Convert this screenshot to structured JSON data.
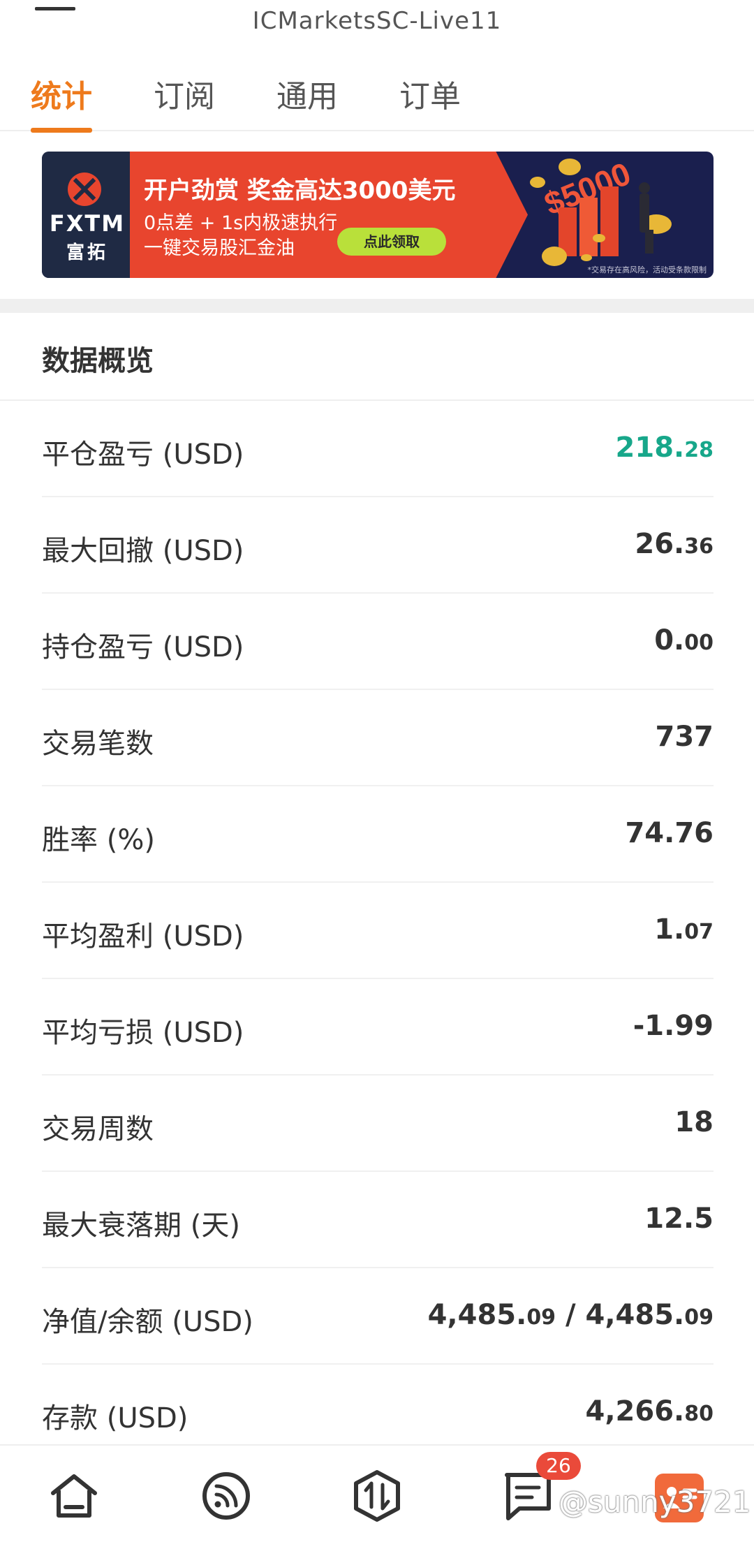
{
  "header": {
    "title": "ICMarketsSC-Live11"
  },
  "tabs": [
    {
      "label": "统计",
      "active": true
    },
    {
      "label": "订阅",
      "active": false
    },
    {
      "label": "通用",
      "active": false
    },
    {
      "label": "订单",
      "active": false
    }
  ],
  "banner": {
    "logo_text": "FXTM",
    "logo_sub": "富拓",
    "headline": "开户劲赏 奖金高达3000美元",
    "line1": "0点差 + 1s内极速执行",
    "line2": "一键交易股汇金油",
    "cta": "点此领取",
    "art_text": "$5000",
    "disclaimer": "*交易存在高风险，活动受条款限制"
  },
  "overview": {
    "title": "数据概览",
    "rows": [
      {
        "label": "平仓盈亏 (USD)",
        "main": "218.",
        "decimal": "28",
        "color": "#17a78a"
      },
      {
        "label": "最大回撤 (USD)",
        "main": "26.",
        "decimal": "36"
      },
      {
        "label": "持仓盈亏 (USD)",
        "main": "0.",
        "decimal": "00"
      },
      {
        "label": "交易笔数",
        "main": "737",
        "decimal": ""
      },
      {
        "label": "胜率 (%)",
        "main": "74.76",
        "decimal": ""
      },
      {
        "label": "平均盈利 (USD)",
        "main": "1.",
        "decimal": "07"
      },
      {
        "label": "平均亏损 (USD)",
        "main": "-1.99",
        "decimal": ""
      },
      {
        "label": "交易周数",
        "main": "18",
        "decimal": ""
      },
      {
        "label": "最大衰落期 (天)",
        "main": "12.5",
        "decimal": ""
      },
      {
        "label": "净值/余额 (USD)",
        "main": "4,485.",
        "decimal": "09",
        "main2": " / 4,485.",
        "decimal2": "09"
      },
      {
        "label": "存款 (USD)",
        "main": "4,266.",
        "decimal": "80"
      }
    ]
  },
  "bottom_nav": {
    "items": [
      {
        "icon": "home-icon"
      },
      {
        "icon": "signal-feed-icon"
      },
      {
        "icon": "trade-arrows-icon"
      },
      {
        "icon": "messages-icon",
        "badge": "26"
      },
      {
        "icon": "profile-icon"
      }
    ],
    "watermark": "@sunny3721"
  },
  "colors": {
    "accent": "#ee7a1c",
    "positive": "#17a78a",
    "badge": "#ea4a3a"
  }
}
